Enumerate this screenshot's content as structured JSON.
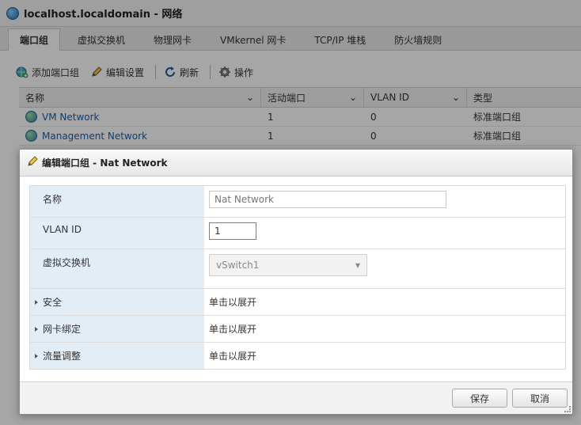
{
  "window": {
    "title": "localhost.localdomain - 网络"
  },
  "tabs": [
    {
      "label": "端口组"
    },
    {
      "label": "虚拟交换机"
    },
    {
      "label": "物理网卡"
    },
    {
      "label": "VMkernel 网卡"
    },
    {
      "label": "TCP/IP 堆栈"
    },
    {
      "label": "防火墙规则"
    }
  ],
  "toolbar": {
    "add": "添加端口组",
    "edit": "编辑设置",
    "refresh": "刷新",
    "actions": "操作"
  },
  "grid": {
    "columns": [
      "名称",
      "活动端口",
      "VLAN ID",
      "类型"
    ],
    "rows": [
      {
        "name": "VM Network",
        "ports": "1",
        "vlan": "0",
        "type": "标准端口组"
      },
      {
        "name": "Management Network",
        "ports": "1",
        "vlan": "0",
        "type": "标准端口组"
      }
    ]
  },
  "dialog": {
    "title": "编辑端口组 - Nat Network",
    "fields": {
      "name_label": "名称",
      "name_placeholder": "Nat Network",
      "vlan_label": "VLAN ID",
      "vlan_value": "1",
      "vswitch_label": "虚拟交换机",
      "vswitch_value": "vSwitch1"
    },
    "sections": [
      {
        "label": "安全",
        "value": "单击以展开"
      },
      {
        "label": "网卡绑定",
        "value": "单击以展开"
      },
      {
        "label": "流量调整",
        "value": "单击以展开"
      }
    ],
    "save": "保存",
    "cancel": "取消"
  },
  "colors": {
    "label_bg": "#e3edf6",
    "link": "#1a5fa8",
    "overlay": "rgba(0,0,0,0.35)"
  }
}
